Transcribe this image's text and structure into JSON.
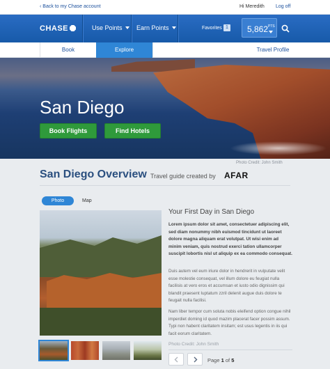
{
  "util": {
    "back": "‹ Back to my Chase account",
    "greeting": "Hi Meredith",
    "logout": "Log off"
  },
  "nav": {
    "logo": "CHASE",
    "use_points": "Use Points",
    "earn_points": "Earn Points",
    "favorites": "Favorites",
    "favorites_count": "1",
    "points": "5,862",
    "points_unit": "PTS"
  },
  "tabs": [
    "Book",
    "Explore",
    "Travel Profile"
  ],
  "hero": {
    "city": "San Diego",
    "book_flights": "Book Flights",
    "find_hotels": "Find Hotels",
    "photo_credit": "Photo Credit: John Smith"
  },
  "overview": {
    "title": "San Diego Overview",
    "subtitle": "Travel guide created by",
    "brand": "AFAR"
  },
  "toggle": {
    "photo": "Photo",
    "map": "Map"
  },
  "article": {
    "heading": "Your First Day in San Diego",
    "lead": "Lorem ipsum dolor sit amet, consectetuer adipiscing elit, sed diam nonummy nibh euismod tincidunt ut laoreet dolore magna aliquam erat volutpat. Ut wisi enim ad minim veniam, quis nostrud exerci tation ullamcorper suscipit lobortis nisl ut aliquip ex ea commodo consequat.",
    "p1": "Duis autem vel eum iriure dolor in hendrerit in vulputate velit esse molestie consequat, vel illum dolore eu feugiat nulla facilisis at vero eros et accumsan et iusto odio dignissim qui blandit praesent luptatum zzril delenit augue duis dolore te feugait nulla facilisi.",
    "p2": "Nam liber tempor cum soluta nobis eleifend option congue nihil imperdiet doming id quod mazim placerat facer possim assum. Typi non habent claritatem insitam; est usus legentis in iis qui facit eorum claritatem.",
    "photo_credit": "Photo Credit: John Smith"
  },
  "pager": {
    "prefix": "Page",
    "current": "1",
    "of": "of",
    "total": "5"
  }
}
